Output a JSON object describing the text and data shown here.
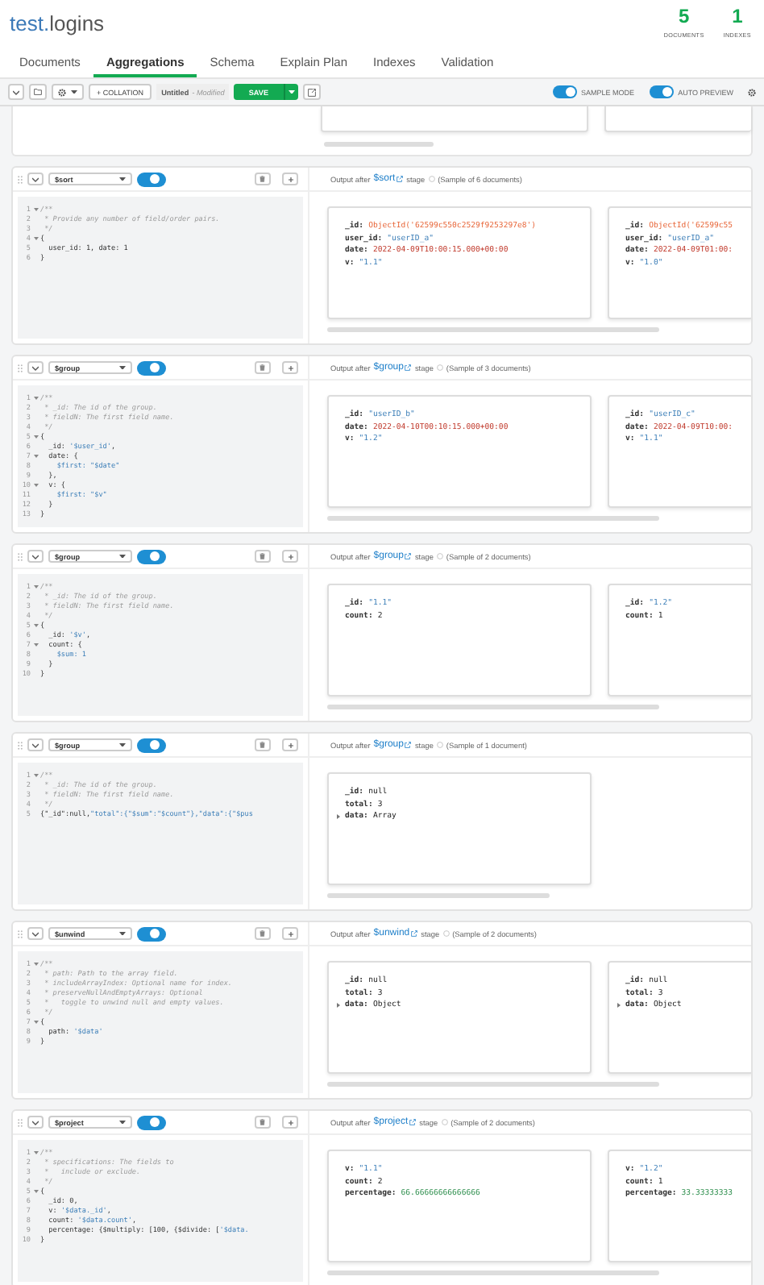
{
  "header": {
    "db": "test.",
    "collection": "logins",
    "stats": [
      {
        "value": "5",
        "label": "DOCUMENTS"
      },
      {
        "value": "1",
        "label": "INDEXES"
      }
    ]
  },
  "tabs": [
    {
      "label": "Documents",
      "selected": false
    },
    {
      "label": "Aggregations",
      "selected": true
    },
    {
      "label": "Schema",
      "selected": false
    },
    {
      "label": "Explain Plan",
      "selected": false
    },
    {
      "label": "Indexes",
      "selected": false
    },
    {
      "label": "Validation",
      "selected": false
    }
  ],
  "toolbar": {
    "collation": "+ COLLATION",
    "pipeline_name": "Untitled",
    "pipeline_state": "- Modified",
    "save": "SAVE",
    "toggles": [
      {
        "label": "SAMPLE MODE",
        "on": true
      },
      {
        "label": "AUTO PREVIEW",
        "on": true
      }
    ]
  },
  "stages": [
    {
      "operator": "$sort",
      "enabled": true,
      "output_prefix": "Output after",
      "link": "$sort",
      "output_suffix": "stage",
      "sample": "(Sample of 6 documents)",
      "code": [
        {
          "n": "1",
          "fold": true,
          "parts": [
            {
              "kind": "comment",
              "text": "/**"
            }
          ]
        },
        {
          "n": "2",
          "fold": false,
          "parts": [
            {
              "kind": "comment",
              "text": " * Provide any number of field/order pairs."
            }
          ]
        },
        {
          "n": "3",
          "fold": false,
          "parts": [
            {
              "kind": "comment",
              "text": " */"
            }
          ]
        },
        {
          "n": "4",
          "fold": true,
          "parts": [
            {
              "kind": "plain",
              "text": "{"
            }
          ]
        },
        {
          "n": "5",
          "fold": false,
          "parts": [
            {
              "kind": "plain",
              "text": "  user_id: 1, date: 1"
            }
          ]
        },
        {
          "n": "6",
          "fold": false,
          "parts": [
            {
              "kind": "plain",
              "text": "}"
            }
          ]
        }
      ],
      "docs": [
        {
          "fields": [
            {
              "key": "_id:",
              "value": "ObjectId('62599c550c2529f9253297e8')",
              "kind": "objectid"
            },
            {
              "key": "user_id:",
              "value": "\"userID_a\"",
              "kind": "string"
            },
            {
              "key": "date:",
              "value": "2022-04-09T10:00:15.000+00:00",
              "kind": "date"
            },
            {
              "key": "v:",
              "value": "\"1.1\"",
              "kind": "string"
            }
          ]
        },
        {
          "fields": [
            {
              "key": "_id:",
              "value": "ObjectId('62599c55",
              "kind": "objectid"
            },
            {
              "key": "user_id:",
              "value": "\"userID_a\"",
              "kind": "string"
            },
            {
              "key": "date:",
              "value": "2022-04-09T01:00:",
              "kind": "date"
            },
            {
              "key": "v:",
              "value": "\"1.0\"",
              "kind": "string"
            }
          ]
        }
      ]
    },
    {
      "operator": "$group",
      "enabled": true,
      "output_prefix": "Output after",
      "link": "$group",
      "output_suffix": "stage",
      "sample": "(Sample of 3 documents)",
      "code": [
        {
          "n": "1",
          "fold": true,
          "parts": [
            {
              "kind": "comment",
              "text": "/**"
            }
          ]
        },
        {
          "n": "2",
          "fold": false,
          "parts": [
            {
              "kind": "comment",
              "text": " * _id: The id of the group."
            }
          ]
        },
        {
          "n": "3",
          "fold": false,
          "parts": [
            {
              "kind": "comment",
              "text": " * fieldN: The first field name."
            }
          ]
        },
        {
          "n": "4",
          "fold": false,
          "parts": [
            {
              "kind": "comment",
              "text": " */"
            }
          ]
        },
        {
          "n": "5",
          "fold": true,
          "parts": [
            {
              "kind": "plain",
              "text": "{"
            }
          ]
        },
        {
          "n": "6",
          "fold": false,
          "parts": [
            {
              "kind": "plain",
              "text": "  _id: "
            },
            {
              "kind": "string",
              "text": "'$user_id'"
            },
            {
              "kind": "plain",
              "text": ","
            }
          ]
        },
        {
          "n": "7",
          "fold": true,
          "parts": [
            {
              "kind": "plain",
              "text": "  date: {"
            }
          ]
        },
        {
          "n": "8",
          "fold": false,
          "parts": [
            {
              "kind": "string",
              "text": "    $first: \"$date\""
            }
          ]
        },
        {
          "n": "9",
          "fold": false,
          "parts": [
            {
              "kind": "plain",
              "text": "  },"
            }
          ]
        },
        {
          "n": "10",
          "fold": true,
          "parts": [
            {
              "kind": "plain",
              "text": "  v: {"
            }
          ]
        },
        {
          "n": "11",
          "fold": false,
          "parts": [
            {
              "kind": "string",
              "text": "    $first: \"$v\""
            }
          ]
        },
        {
          "n": "12",
          "fold": false,
          "parts": [
            {
              "kind": "plain",
              "text": "  }"
            }
          ]
        },
        {
          "n": "13",
          "fold": false,
          "parts": [
            {
              "kind": "plain",
              "text": "}"
            }
          ]
        }
      ],
      "docs": [
        {
          "fields": [
            {
              "key": "_id:",
              "value": "\"userID_b\"",
              "kind": "string"
            },
            {
              "key": "date:",
              "value": "2022-04-10T00:10:15.000+00:00",
              "kind": "date"
            },
            {
              "key": "v:",
              "value": "\"1.2\"",
              "kind": "string"
            }
          ]
        },
        {
          "fields": [
            {
              "key": "_id:",
              "value": "\"userID_c\"",
              "kind": "string"
            },
            {
              "key": "date:",
              "value": "2022-04-09T10:00:",
              "kind": "date"
            },
            {
              "key": "v:",
              "value": "\"1.1\"",
              "kind": "string"
            }
          ]
        }
      ]
    },
    {
      "operator": "$group",
      "enabled": true,
      "output_prefix": "Output after",
      "link": "$group",
      "output_suffix": "stage",
      "sample": "(Sample of 2 documents)",
      "code": [
        {
          "n": "1",
          "fold": true,
          "parts": [
            {
              "kind": "comment",
              "text": "/**"
            }
          ]
        },
        {
          "n": "2",
          "fold": false,
          "parts": [
            {
              "kind": "comment",
              "text": " * _id: The id of the group."
            }
          ]
        },
        {
          "n": "3",
          "fold": false,
          "parts": [
            {
              "kind": "comment",
              "text": " * fieldN: The first field name."
            }
          ]
        },
        {
          "n": "4",
          "fold": false,
          "parts": [
            {
              "kind": "comment",
              "text": " */"
            }
          ]
        },
        {
          "n": "5",
          "fold": true,
          "parts": [
            {
              "kind": "plain",
              "text": "{"
            }
          ]
        },
        {
          "n": "6",
          "fold": false,
          "parts": [
            {
              "kind": "plain",
              "text": "  _id: "
            },
            {
              "kind": "string",
              "text": "'$v'"
            },
            {
              "kind": "plain",
              "text": ","
            }
          ]
        },
        {
          "n": "7",
          "fold": true,
          "parts": [
            {
              "kind": "plain",
              "text": "  count: {"
            }
          ]
        },
        {
          "n": "8",
          "fold": false,
          "parts": [
            {
              "kind": "string",
              "text": "    $sum: 1"
            }
          ]
        },
        {
          "n": "9",
          "fold": false,
          "parts": [
            {
              "kind": "plain",
              "text": "  }"
            }
          ]
        },
        {
          "n": "10",
          "fold": false,
          "parts": [
            {
              "kind": "plain",
              "text": "}"
            }
          ]
        }
      ],
      "docs": [
        {
          "fields": [
            {
              "key": "_id:",
              "value": "\"1.1\"",
              "kind": "string"
            },
            {
              "key": "count:",
              "value": "2",
              "kind": "plain"
            }
          ]
        },
        {
          "fields": [
            {
              "key": "_id:",
              "value": "\"1.2\"",
              "kind": "string"
            },
            {
              "key": "count:",
              "value": "1",
              "kind": "plain"
            }
          ]
        }
      ]
    },
    {
      "operator": "$group",
      "enabled": true,
      "output_prefix": "Output after",
      "link": "$group",
      "output_suffix": "stage",
      "sample": "(Sample of 1 document)",
      "code": [
        {
          "n": "1",
          "fold": true,
          "parts": [
            {
              "kind": "comment",
              "text": "/**"
            }
          ]
        },
        {
          "n": "2",
          "fold": false,
          "parts": [
            {
              "kind": "comment",
              "text": " * _id: The id of the group."
            }
          ]
        },
        {
          "n": "3",
          "fold": false,
          "parts": [
            {
              "kind": "comment",
              "text": " * fieldN: The first field name."
            }
          ]
        },
        {
          "n": "4",
          "fold": false,
          "parts": [
            {
              "kind": "comment",
              "text": " */"
            }
          ]
        },
        {
          "n": "5",
          "fold": false,
          "parts": [
            {
              "kind": "plain",
              "text": "{\"_id\":null,"
            },
            {
              "kind": "string",
              "text": "\"total\":{\"$sum\":\"$count\"},\"data\":{\"$pus"
            }
          ]
        }
      ],
      "docs": [
        {
          "fields": [
            {
              "key": "_id:",
              "value": "null",
              "kind": "plain"
            },
            {
              "key": "total:",
              "value": "3",
              "kind": "plain"
            },
            {
              "key": "data:",
              "value": "Array",
              "kind": "plain",
              "expandable": true
            }
          ]
        }
      ]
    },
    {
      "operator": "$unwind",
      "enabled": true,
      "output_prefix": "Output after",
      "link": "$unwind",
      "output_suffix": "stage",
      "sample": "(Sample of 2 documents)",
      "code": [
        {
          "n": "1",
          "fold": true,
          "parts": [
            {
              "kind": "comment",
              "text": "/**"
            }
          ]
        },
        {
          "n": "2",
          "fold": false,
          "parts": [
            {
              "kind": "comment",
              "text": " * path: Path to the array field."
            }
          ]
        },
        {
          "n": "3",
          "fold": false,
          "parts": [
            {
              "kind": "comment",
              "text": " * includeArrayIndex: Optional name for index."
            }
          ]
        },
        {
          "n": "4",
          "fold": false,
          "parts": [
            {
              "kind": "comment",
              "text": " * preserveNullAndEmptyArrays: Optional"
            }
          ]
        },
        {
          "n": "5",
          "fold": false,
          "parts": [
            {
              "kind": "comment",
              "text": " *   toggle to unwind null and empty values."
            }
          ]
        },
        {
          "n": "6",
          "fold": false,
          "parts": [
            {
              "kind": "comment",
              "text": " */"
            }
          ]
        },
        {
          "n": "7",
          "fold": true,
          "parts": [
            {
              "kind": "plain",
              "text": "{"
            }
          ]
        },
        {
          "n": "8",
          "fold": false,
          "parts": [
            {
              "kind": "plain",
              "text": "  path: "
            },
            {
              "kind": "string",
              "text": "'$data'"
            }
          ]
        },
        {
          "n": "9",
          "fold": false,
          "parts": [
            {
              "kind": "plain",
              "text": "}"
            }
          ]
        }
      ],
      "docs": [
        {
          "fields": [
            {
              "key": "_id:",
              "value": "null",
              "kind": "plain"
            },
            {
              "key": "total:",
              "value": "3",
              "kind": "plain"
            },
            {
              "key": "data:",
              "value": "Object",
              "kind": "plain",
              "expandable": true
            }
          ]
        },
        {
          "fields": [
            {
              "key": "_id:",
              "value": "null",
              "kind": "plain"
            },
            {
              "key": "total:",
              "value": "3",
              "kind": "plain"
            },
            {
              "key": "data:",
              "value": "Object",
              "kind": "plain",
              "expandable": true
            }
          ]
        }
      ]
    },
    {
      "operator": "$project",
      "enabled": true,
      "output_prefix": "Output after",
      "link": "$project",
      "output_suffix": "stage",
      "sample": "(Sample of 2 documents)",
      "code": [
        {
          "n": "1",
          "fold": true,
          "parts": [
            {
              "kind": "comment",
              "text": "/**"
            }
          ]
        },
        {
          "n": "2",
          "fold": false,
          "parts": [
            {
              "kind": "comment",
              "text": " * specifications: The fields to"
            }
          ]
        },
        {
          "n": "3",
          "fold": false,
          "parts": [
            {
              "kind": "comment",
              "text": " *   include or exclude."
            }
          ]
        },
        {
          "n": "4",
          "fold": false,
          "parts": [
            {
              "kind": "comment",
              "text": " */"
            }
          ]
        },
        {
          "n": "5",
          "fold": true,
          "parts": [
            {
              "kind": "plain",
              "text": "{"
            }
          ]
        },
        {
          "n": "6",
          "fold": false,
          "parts": [
            {
              "kind": "plain",
              "text": "  _id: 0,"
            }
          ]
        },
        {
          "n": "7",
          "fold": false,
          "parts": [
            {
              "kind": "plain",
              "text": "  v: "
            },
            {
              "kind": "string",
              "text": "'$data._id'"
            },
            {
              "kind": "plain",
              "text": ","
            }
          ]
        },
        {
          "n": "8",
          "fold": false,
          "parts": [
            {
              "kind": "plain",
              "text": "  count: "
            },
            {
              "kind": "string",
              "text": "'$data.count'"
            },
            {
              "kind": "plain",
              "text": ","
            }
          ]
        },
        {
          "n": "9",
          "fold": false,
          "parts": [
            {
              "kind": "plain",
              "text": "  percentage: {$multiply: [100, {$divide: ["
            },
            {
              "kind": "string",
              "text": "'$data."
            }
          ]
        },
        {
          "n": "10",
          "fold": false,
          "parts": [
            {
              "kind": "plain",
              "text": "}"
            }
          ]
        }
      ],
      "docs": [
        {
          "fields": [
            {
              "key": "v:",
              "value": "\"1.1\"",
              "kind": "string"
            },
            {
              "key": "count:",
              "value": "2",
              "kind": "plain"
            },
            {
              "key": "percentage:",
              "value": "66.66666666666666",
              "kind": "number"
            }
          ]
        },
        {
          "fields": [
            {
              "key": "v:",
              "value": "\"1.2\"",
              "kind": "string"
            },
            {
              "key": "count:",
              "value": "1",
              "kind": "plain"
            },
            {
              "key": "percentage:",
              "value": "33.33333333",
              "kind": "number"
            }
          ]
        }
      ]
    }
  ]
}
